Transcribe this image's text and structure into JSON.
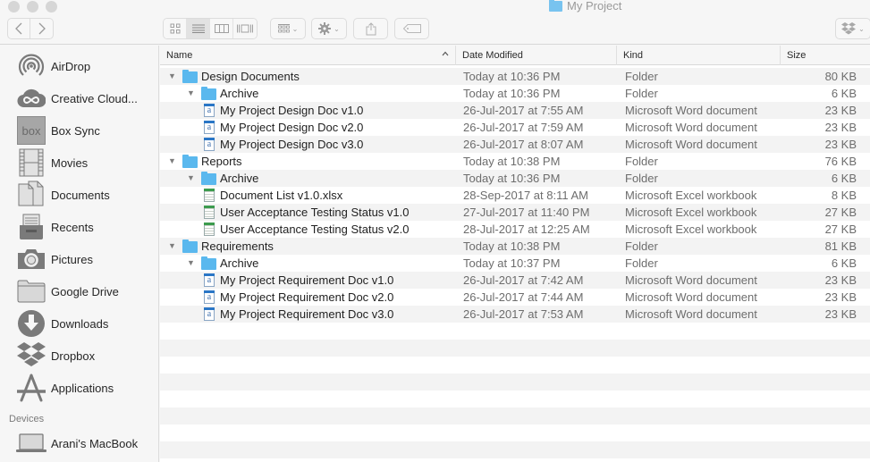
{
  "window": {
    "title": "My Project"
  },
  "toolbar": {
    "back_icon": "chevron-left",
    "forward_icon": "chevron-right",
    "views": [
      "icon-view",
      "list-view",
      "column-view",
      "cover-flow-view"
    ],
    "active_view": "list-view",
    "arrange_icon": "arrange-grid",
    "action_icon": "gear",
    "share_icon": "share",
    "tag_icon": "tag",
    "dropbox_icon": "dropbox"
  },
  "sidebar": {
    "items": [
      {
        "label": "AirDrop",
        "icon": "airdrop"
      },
      {
        "label": "Creative Cloud...",
        "icon": "creative-cloud"
      },
      {
        "label": "Box Sync",
        "icon": "box"
      },
      {
        "label": "Movies",
        "icon": "film"
      },
      {
        "label": "Documents",
        "icon": "documents"
      },
      {
        "label": "Recents",
        "icon": "recents-tray"
      },
      {
        "label": "Pictures",
        "icon": "camera"
      },
      {
        "label": "Google Drive",
        "icon": "folder"
      },
      {
        "label": "Downloads",
        "icon": "download-arrow"
      },
      {
        "label": "Dropbox",
        "icon": "dropbox"
      },
      {
        "label": "Applications",
        "icon": "applications"
      }
    ],
    "devices_header": "Devices",
    "devices": [
      {
        "label": "Arani's MacBook",
        "icon": "laptop"
      }
    ]
  },
  "table": {
    "columns": {
      "name": "Name",
      "date": "Date Modified",
      "kind": "Kind",
      "size": "Size"
    },
    "sort_indicator": "^",
    "rows": [
      {
        "name": "Design Documents",
        "date": "Today at 10:36 PM",
        "kind": "Folder",
        "size": "80 KB",
        "type": "folder",
        "level": 0,
        "expanded": true
      },
      {
        "name": "Archive",
        "date": "Today at 10:36 PM",
        "kind": "Folder",
        "size": "6 KB",
        "type": "folder",
        "level": 1,
        "expanded": true
      },
      {
        "name": "My Project Design Doc v1.0",
        "date": "26-Jul-2017 at 7:55 AM",
        "kind": "Microsoft Word document",
        "size": "23 KB",
        "type": "word",
        "level": 2
      },
      {
        "name": "My Project Design Doc v2.0",
        "date": "26-Jul-2017 at 7:59 AM",
        "kind": "Microsoft Word document",
        "size": "23 KB",
        "type": "word",
        "level": 2
      },
      {
        "name": "My Project Design Doc v3.0",
        "date": "26-Jul-2017 at 8:07 AM",
        "kind": "Microsoft Word document",
        "size": "23 KB",
        "type": "word",
        "level": 2
      },
      {
        "name": "Reports",
        "date": "Today at 10:38 PM",
        "kind": "Folder",
        "size": "76 KB",
        "type": "folder",
        "level": 0,
        "expanded": true
      },
      {
        "name": "Archive",
        "date": "Today at 10:36 PM",
        "kind": "Folder",
        "size": "6 KB",
        "type": "folder",
        "level": 1,
        "expanded": true
      },
      {
        "name": "Document List v1.0.xlsx",
        "date": "28-Sep-2017 at 8:11 AM",
        "kind": "Microsoft Excel workbook",
        "size": "8 KB",
        "type": "excel",
        "level": 2
      },
      {
        "name": "User Acceptance Testing Status v1.0",
        "date": "27-Jul-2017 at 11:40 PM",
        "kind": "Microsoft Excel workbook",
        "size": "27 KB",
        "type": "excel",
        "level": 2
      },
      {
        "name": "User Acceptance Testing Status v2.0",
        "date": "28-Jul-2017 at 12:25 AM",
        "kind": "Microsoft Excel workbook",
        "size": "27 KB",
        "type": "excel",
        "level": 2
      },
      {
        "name": "Requirements",
        "date": "Today at 10:38 PM",
        "kind": "Folder",
        "size": "81 KB",
        "type": "folder",
        "level": 0,
        "expanded": true
      },
      {
        "name": "Archive",
        "date": "Today at 10:37 PM",
        "kind": "Folder",
        "size": "6 KB",
        "type": "folder",
        "level": 1,
        "expanded": true
      },
      {
        "name": "My Project Requirement Doc v1.0",
        "date": "26-Jul-2017 at 7:42 AM",
        "kind": "Microsoft Word document",
        "size": "23 KB",
        "type": "word",
        "level": 2
      },
      {
        "name": "My Project Requirement Doc v2.0",
        "date": "26-Jul-2017 at 7:44 AM",
        "kind": "Microsoft Word document",
        "size": "23 KB",
        "type": "word",
        "level": 2
      },
      {
        "name": "My Project Requirement Doc v3.0",
        "date": "26-Jul-2017 at 7:53 AM",
        "kind": "Microsoft Word document",
        "size": "23 KB",
        "type": "word",
        "level": 2
      }
    ]
  }
}
